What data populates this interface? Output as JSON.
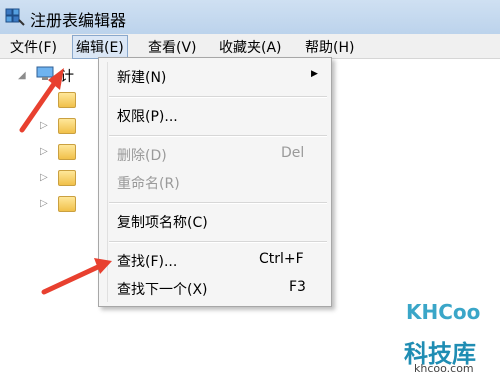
{
  "window": {
    "title": "注册表编辑器"
  },
  "menubar": {
    "items": [
      {
        "label": "文件(F)"
      },
      {
        "label": "编辑(E)"
      },
      {
        "label": "查看(V)"
      },
      {
        "label": "收藏夹(A)"
      },
      {
        "label": "帮助(H)"
      }
    ]
  },
  "tree": {
    "root_label": "计"
  },
  "edit_menu": {
    "items": [
      {
        "label": "新建(N)",
        "shortcut": ""
      },
      {
        "label": "权限(P)...",
        "shortcut": ""
      },
      {
        "label": "删除(D)",
        "shortcut": "Del"
      },
      {
        "label": "重命名(R)",
        "shortcut": ""
      },
      {
        "label": "复制项名称(C)",
        "shortcut": ""
      },
      {
        "label": "查找(F)...",
        "shortcut": "Ctrl+F"
      },
      {
        "label": "查找下一个(X)",
        "shortcut": "F3"
      }
    ]
  },
  "watermark": {
    "brand": "KHCoo",
    "cn": "科技库",
    "url": "khcoo.com"
  },
  "colors": {
    "annotation_arrow": "#e8402f",
    "menu_highlight": "#dbe7f6",
    "watermark": "#1f8db3"
  }
}
